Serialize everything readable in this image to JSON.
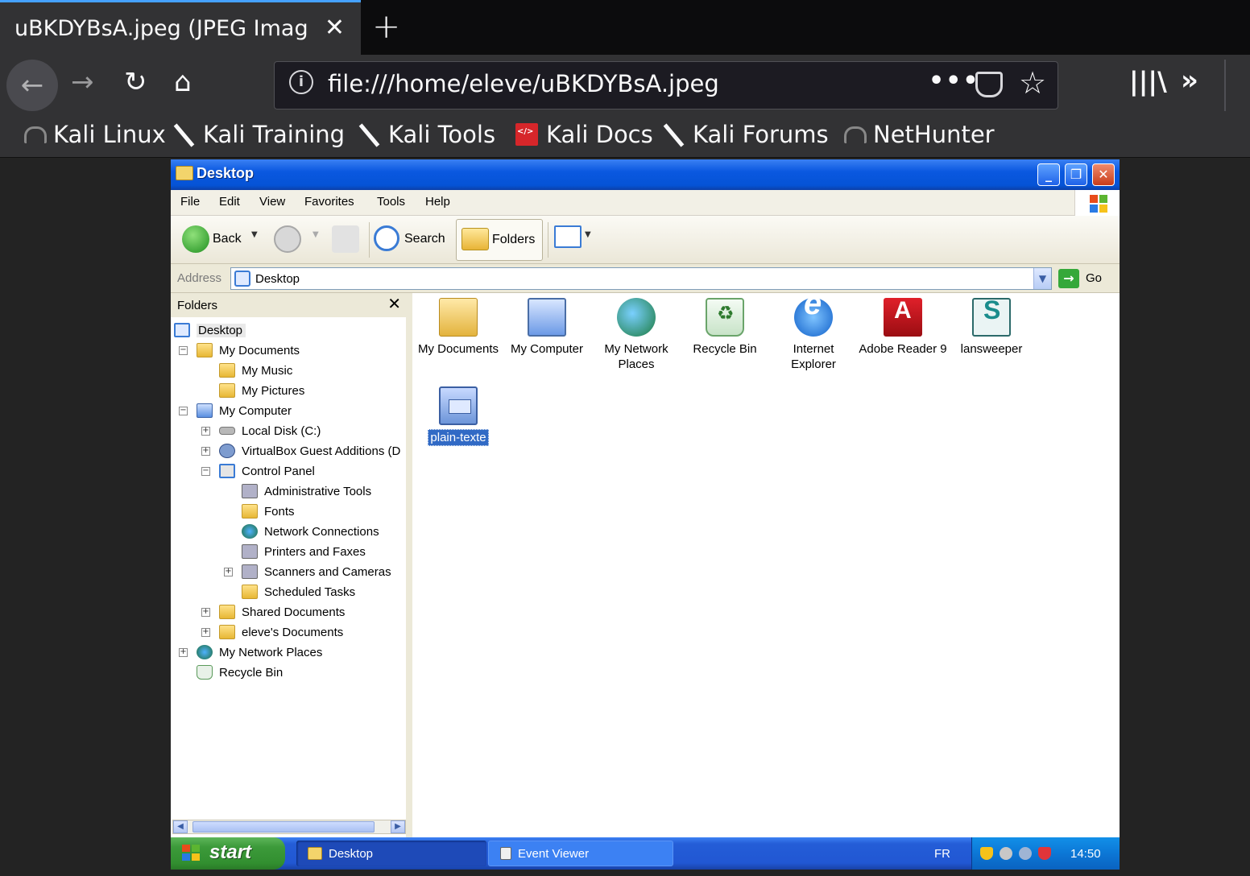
{
  "browser": {
    "tab_title": "uBKDYBsA.jpeg (JPEG Imag",
    "url": "file:///home/eleve/uBKDYBsA.jpeg",
    "bookmarks": [
      {
        "label": "Kali Linux",
        "icon": "dragon-icon"
      },
      {
        "label": "Kali Training",
        "icon": "slash-icon"
      },
      {
        "label": "Kali Tools",
        "icon": "slash-icon"
      },
      {
        "label": "Kali Docs",
        "icon": "docs-icon"
      },
      {
        "label": "Kali Forums",
        "icon": "slash-icon"
      },
      {
        "label": "NetHunter",
        "icon": "dragon-icon"
      }
    ]
  },
  "explorer": {
    "title": "Desktop",
    "menu": [
      "File",
      "Edit",
      "View",
      "Favorites",
      "Tools",
      "Help"
    ],
    "toolbar": {
      "back": "Back",
      "search": "Search",
      "folders": "Folders"
    },
    "address": {
      "label": "Address",
      "value": "Desktop",
      "go": "Go"
    },
    "folders_pane": {
      "header": "Folders",
      "tree": [
        {
          "label": "Desktop",
          "icon": "desktop-icon"
        },
        {
          "label": "My Documents",
          "icon": "folder-icon"
        },
        {
          "label": "My Music",
          "icon": "folder-icon"
        },
        {
          "label": "My Pictures",
          "icon": "folder-icon"
        },
        {
          "label": "My Computer",
          "icon": "computer-icon"
        },
        {
          "label": "Local Disk (C:)",
          "icon": "disk-icon"
        },
        {
          "label": "VirtualBox Guest Additions (D",
          "icon": "cd-icon"
        },
        {
          "label": "Control Panel",
          "icon": "control-panel-icon"
        },
        {
          "label": "Administrative Tools",
          "icon": "gear-icon"
        },
        {
          "label": "Fonts",
          "icon": "folder-icon"
        },
        {
          "label": "Network Connections",
          "icon": "network-icon"
        },
        {
          "label": "Printers and Faxes",
          "icon": "printer-icon"
        },
        {
          "label": "Scanners and Cameras",
          "icon": "scanner-icon"
        },
        {
          "label": "Scheduled Tasks",
          "icon": "folder-icon"
        },
        {
          "label": "Shared Documents",
          "icon": "folder-icon"
        },
        {
          "label": "eleve's Documents",
          "icon": "folder-icon"
        },
        {
          "label": "My Network Places",
          "icon": "network-icon"
        },
        {
          "label": "Recycle Bin",
          "icon": "recycle-bin-icon"
        }
      ]
    },
    "desktop_icons": [
      {
        "label": "My Documents",
        "icon": "my-documents-icon"
      },
      {
        "label": "My Computer",
        "icon": "my-computer-icon"
      },
      {
        "label": "My Network Places",
        "icon": "network-places-icon"
      },
      {
        "label": "Recycle Bin",
        "icon": "recycle-bin-icon"
      },
      {
        "label": "Internet Explorer",
        "icon": "internet-explorer-icon"
      },
      {
        "label": "Adobe Reader 9",
        "icon": "adobe-reader-icon"
      },
      {
        "label": "lansweeper",
        "icon": "lansweeper-icon"
      },
      {
        "label": "plain-texte",
        "icon": "text-file-icon"
      }
    ]
  },
  "taskbar": {
    "start": "start",
    "tasks": [
      "Desktop",
      "Event Viewer"
    ],
    "language": "FR",
    "clock": "14:50"
  }
}
